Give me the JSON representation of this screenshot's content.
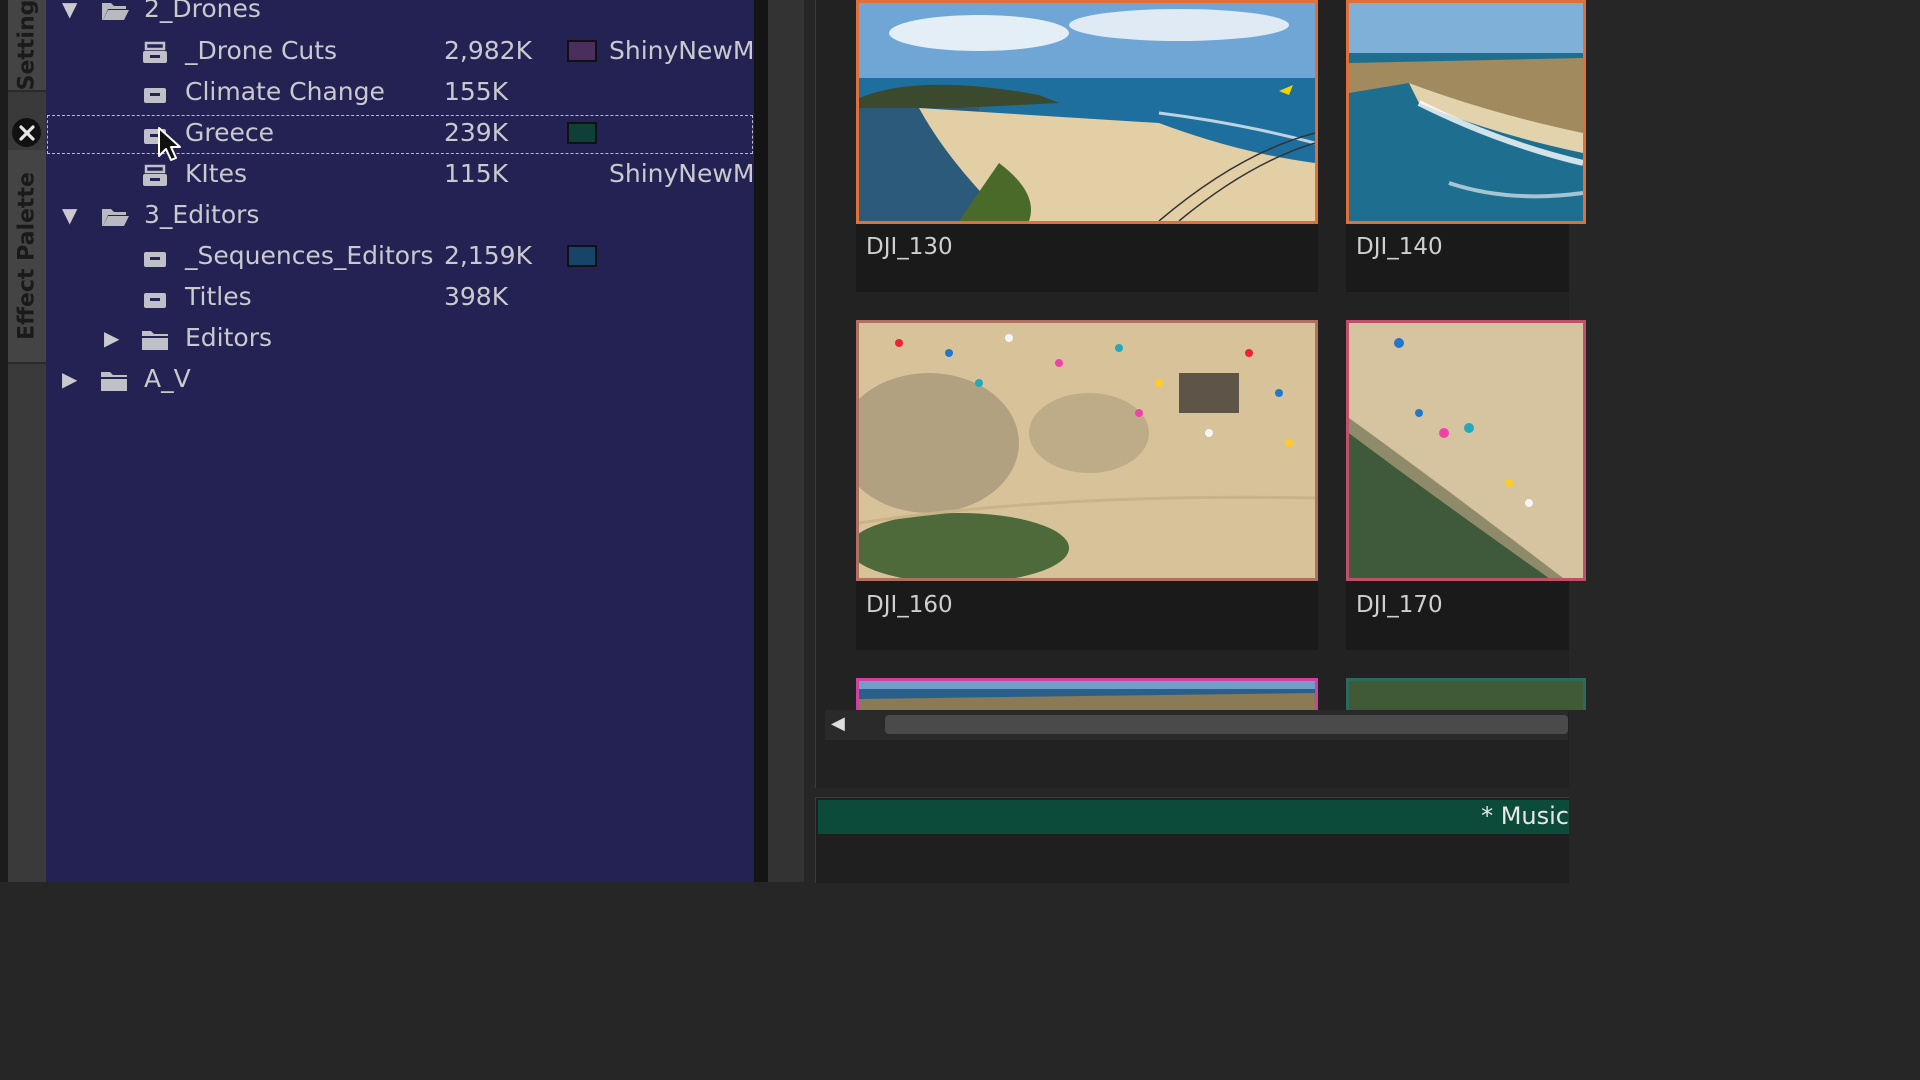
{
  "sidebar_tabs": {
    "settings": "Setting",
    "effect_palette": "Effect Palette"
  },
  "bin_tree": {
    "rows": [
      {
        "name": "2_Drones",
        "type": "folder-open",
        "expander": "expanded"
      },
      {
        "name": "_Drone Cuts",
        "type": "bin-open",
        "size": "2,982K",
        "color": "#4a2f5e",
        "project": "ShinyNewM"
      },
      {
        "name": "Climate Change",
        "type": "bin",
        "size": "155K"
      },
      {
        "name": "Greece",
        "type": "bin",
        "size": "239K",
        "color": "#0f4036",
        "selected": true
      },
      {
        "name": "KItes",
        "type": "bin-open",
        "size": "115K",
        "project": "ShinyNewM"
      },
      {
        "name": "3_Editors",
        "type": "folder-open",
        "expander": "expanded"
      },
      {
        "name": "_Sequences_Editors",
        "type": "bin",
        "size": "2,159K",
        "color": "#17456a"
      },
      {
        "name": "Titles",
        "type": "bin",
        "size": "398K"
      },
      {
        "name": "Editors",
        "type": "folder",
        "expander": "collapsed"
      },
      {
        "name": "A_V",
        "type": "folder",
        "expander": "collapsed"
      }
    ]
  },
  "clips": [
    {
      "name": "DJI_130",
      "border": "#e0703a",
      "scene": "beach-kites"
    },
    {
      "name": "DJI_140",
      "border": "#e0703a",
      "scene": "coast-waves"
    },
    {
      "name": "DJI_160",
      "border": "#b07060",
      "scene": "beach-aerial"
    },
    {
      "name": "DJI_170",
      "border": "#c0506a",
      "scene": "beach-shore"
    }
  ],
  "music_panel": {
    "title": "* Music"
  },
  "icons": {
    "close": "close-icon",
    "scroll_left": "scroll-left-icon",
    "cursor": "mouse-cursor-icon"
  }
}
